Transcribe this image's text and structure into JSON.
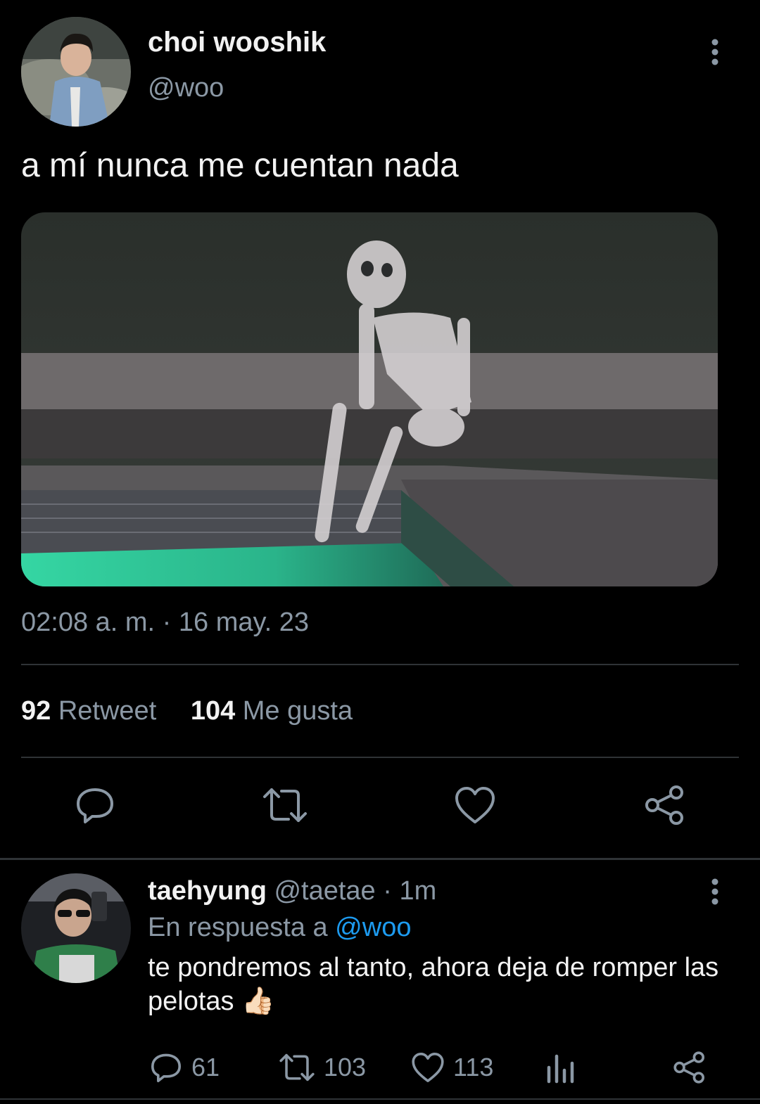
{
  "tweet": {
    "display_name": "choi wooshik",
    "handle": "@woo",
    "text": "a mí nunca me cuentan nada",
    "timestamp": "02:08 a. m. · 16 may. 23",
    "stats": {
      "retweets_count": "92",
      "retweets_label": "Retweet",
      "likes_count": "104",
      "likes_label": "Me gusta"
    },
    "actions": [
      "reply-icon",
      "retweet-icon",
      "like-icon",
      "share-icon"
    ]
  },
  "reply": {
    "display_name": "taehyung",
    "handle": "@taetae",
    "separator": "·",
    "time": "1m",
    "reply_to_prefix": "En respuesta a",
    "reply_to_handle": "@woo",
    "text": "te pondremos al tanto, ahora deja de romper las pelotas",
    "emoji": "👍🏻",
    "counts": {
      "replies": "61",
      "retweets": "103",
      "likes": "113"
    }
  },
  "colors": {
    "background": "#000000",
    "text": "#f2f2f2",
    "secondary": "#8b98a5",
    "accent": "#1d9bf0",
    "divider": "#2f3336"
  }
}
